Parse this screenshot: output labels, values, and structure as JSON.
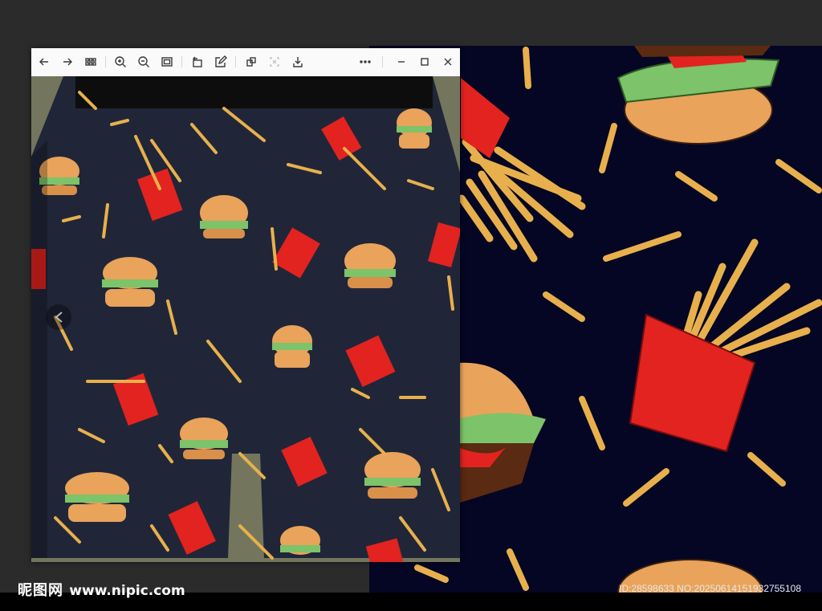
{
  "viewer": {
    "toolbar": {
      "icons": [
        "arrow-left-icon",
        "arrow-right-icon",
        "grid-icon",
        "zoom-in-icon",
        "zoom-out-icon",
        "fit-screen-icon",
        "rotate-icon",
        "edit-icon",
        "copy-icon",
        "crop-icon",
        "download-icon",
        "more-icon",
        "minimize-icon",
        "maximize-icon",
        "close-icon"
      ]
    }
  },
  "watermark": {
    "brand_cn": "昵图网",
    "brand_url": "www.nipic.com",
    "id_text": "ID:28598633 NO:20250614151932755108"
  },
  "colors": {
    "pattern_bg": "#050623",
    "bun": "#e9a35a",
    "lettuce": "#7cc36a",
    "fries": "#e8b04d",
    "box": "#e2231f"
  }
}
